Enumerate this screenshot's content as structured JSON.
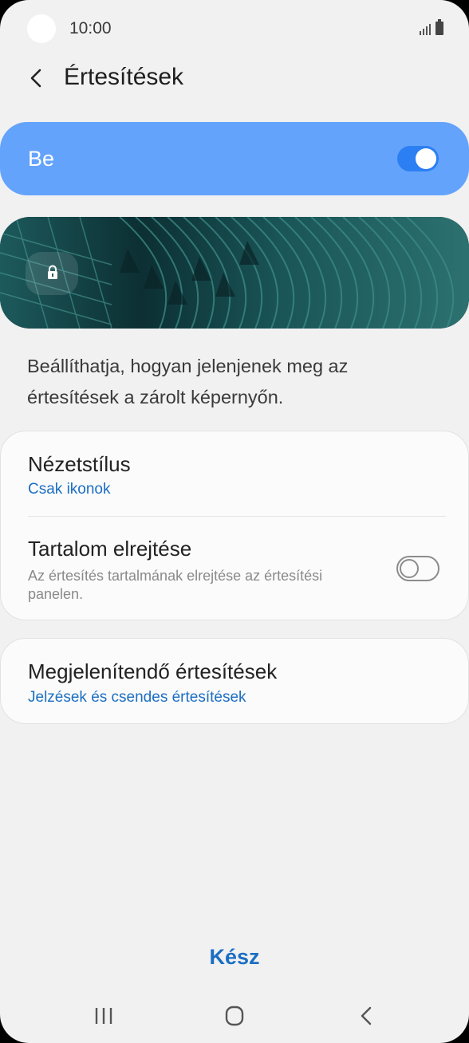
{
  "status_bar": {
    "time": "10:00"
  },
  "header": {
    "title": "Értesítések"
  },
  "master_switch": {
    "label": "Be",
    "state": "on",
    "accent_color": "#64a3fb"
  },
  "description": "Beállíthatja, hogyan jelenjenek meg az értesítések a zárolt képernyőn.",
  "settings": [
    {
      "title": "Nézetstílus",
      "value": "Csak ikonok"
    },
    {
      "title": "Tartalom elrejtése",
      "subtitle": "Az értesítés tartalmának elrejtése az értesítési panelen.",
      "toggle": "off"
    }
  ],
  "notifications_to_show": {
    "title": "Megjelenítendő értesítések",
    "value": "Jelzések és csendes értesítések"
  },
  "done_button": {
    "label": "Kész",
    "color": "#1b6ec2"
  },
  "icons": [
    "back-icon",
    "lock-icon",
    "signal-icon",
    "battery-icon",
    "recents-icon",
    "home-icon",
    "nav-back-icon"
  ]
}
